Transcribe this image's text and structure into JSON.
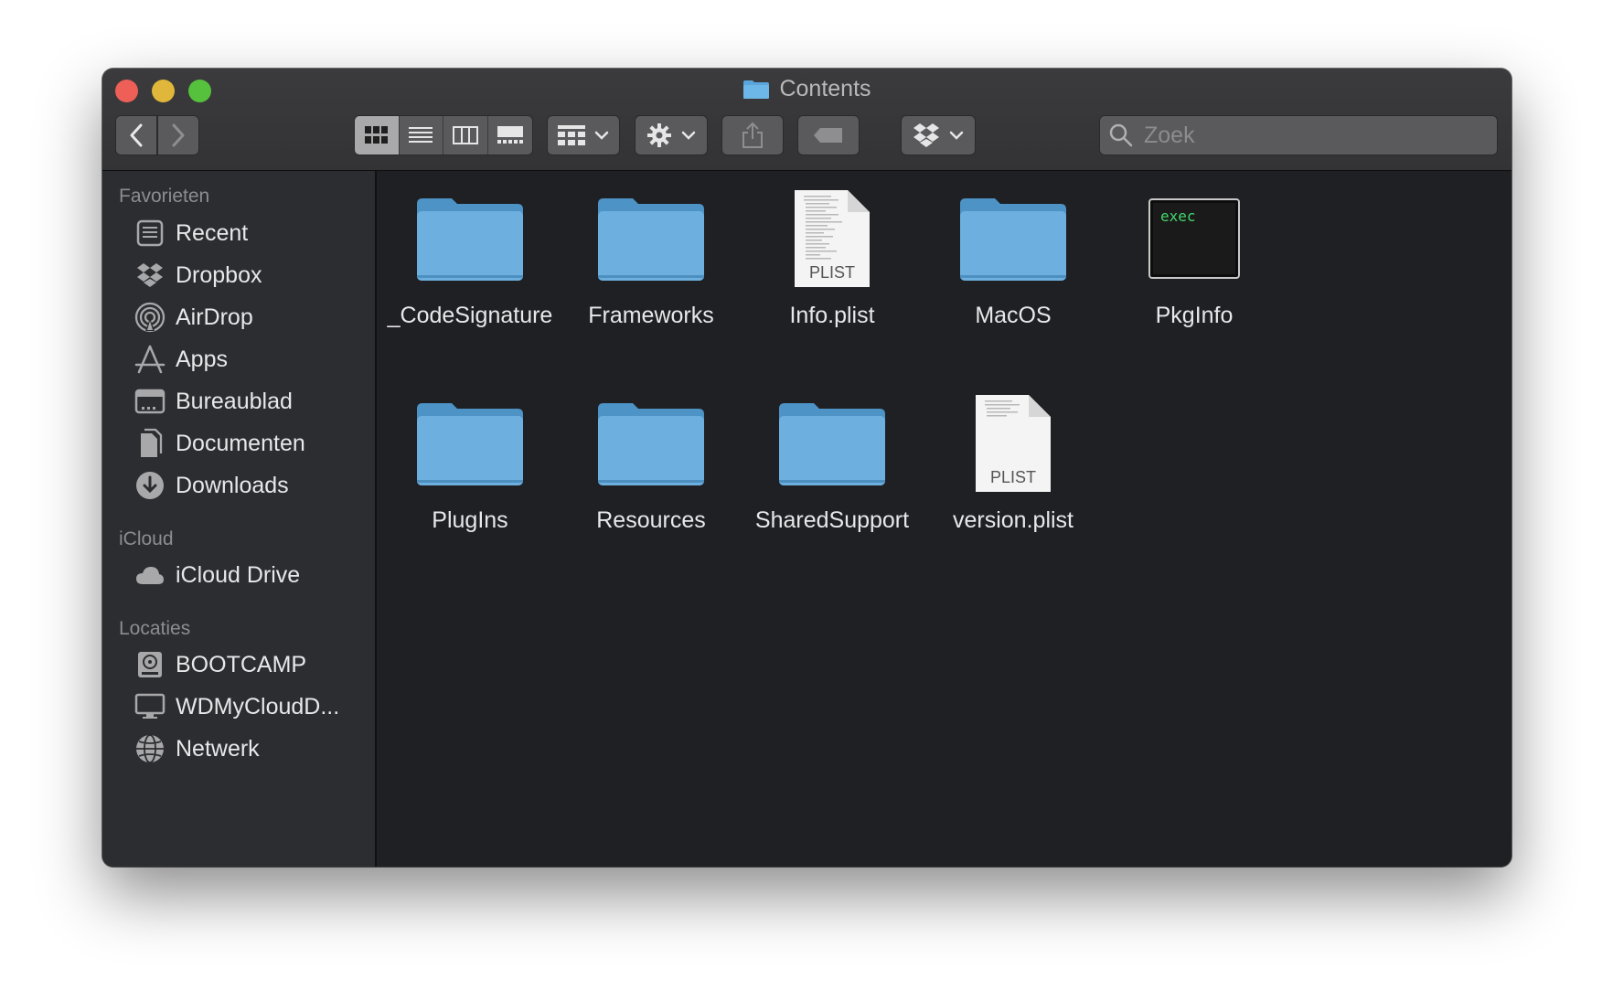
{
  "window": {
    "title": "Contents"
  },
  "toolbar": {
    "back_icon": "chevron-left-icon",
    "forward_icon": "chevron-right-icon",
    "view_modes": [
      "icon-view",
      "list-view",
      "column-view",
      "gallery-view"
    ],
    "active_view": "icon-view",
    "search_placeholder": "Zoek"
  },
  "sidebar": {
    "sections": [
      {
        "title": "Favorieten",
        "items": [
          {
            "label": "Recent",
            "icon": "recent-icon"
          },
          {
            "label": "Dropbox",
            "icon": "dropbox-icon"
          },
          {
            "label": "AirDrop",
            "icon": "airdrop-icon"
          },
          {
            "label": "Apps",
            "icon": "apps-icon"
          },
          {
            "label": "Bureaublad",
            "icon": "desktop-icon"
          },
          {
            "label": "Documenten",
            "icon": "documents-icon"
          },
          {
            "label": "Downloads",
            "icon": "downloads-icon"
          }
        ]
      },
      {
        "title": "iCloud",
        "items": [
          {
            "label": "iCloud Drive",
            "icon": "cloud-icon"
          }
        ]
      },
      {
        "title": "Locaties",
        "items": [
          {
            "label": "BOOTCAMP",
            "icon": "disk-icon"
          },
          {
            "label": "WDMyCloudD...",
            "icon": "monitor-icon"
          },
          {
            "label": "Netwerk",
            "icon": "network-icon"
          }
        ]
      }
    ]
  },
  "files": [
    {
      "name": "_CodeSignature",
      "kind": "folder"
    },
    {
      "name": "Frameworks",
      "kind": "folder"
    },
    {
      "name": "Info.plist",
      "kind": "plist",
      "badge": "PLIST"
    },
    {
      "name": "MacOS",
      "kind": "folder"
    },
    {
      "name": "PkgInfo",
      "kind": "exec",
      "badge": "exec"
    },
    {
      "name": "PlugIns",
      "kind": "folder"
    },
    {
      "name": "Resources",
      "kind": "folder"
    },
    {
      "name": "SharedSupport",
      "kind": "folder"
    },
    {
      "name": "version.plist",
      "kind": "plist",
      "badge": "PLIST"
    }
  ],
  "colors": {
    "close": "#ed5f57",
    "minimize": "#e0b73a",
    "maximize": "#56c13c",
    "folder": "#6db0df",
    "exec_text": "#42d66c"
  }
}
